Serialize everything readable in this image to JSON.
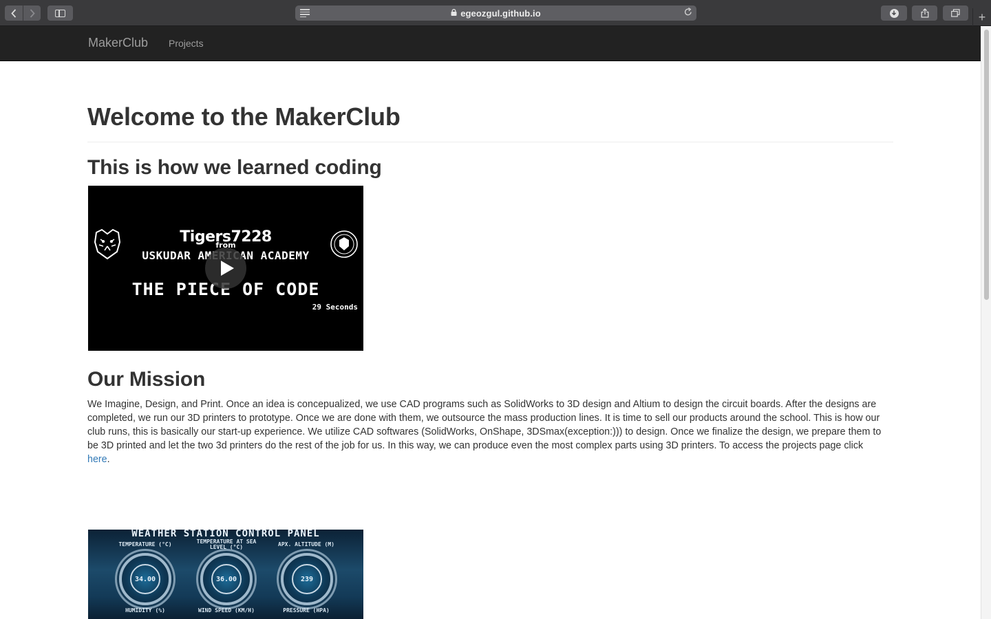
{
  "browser": {
    "url": "egeozgul.github.io",
    "back_icon": "chevron-left-icon",
    "forward_icon": "chevron-right-icon",
    "reload_icon": "reload-icon",
    "new_tab": "+"
  },
  "navbar": {
    "brand": "MakerClub",
    "links": [
      {
        "label": "Projects"
      }
    ],
    "background": "#222222",
    "link_color": "#9d9d9d"
  },
  "main": {
    "title": "Welcome to the MakerClub",
    "coding_heading": "This is how we learned coding",
    "video": {
      "title_line1": "Tigers7228",
      "from": "from",
      "school": "USKUDAR AMERICAN ACADEMY",
      "headline": "THE PIECE OF CODE",
      "duration": "29 Seconds"
    },
    "mission_heading": "Our Mission",
    "mission_text": "We Imagine, Design, and Print. Once an idea is concepualized, we use CAD programs such as SolidWorks to 3D design and Altium to design the circuit boards. After the designs are completed, we run our 3D printers to prototype. Once we are done with them, we outsource the mass production lines. It is time to sell our products around the school. This is how our club runs, this is basically our start-up experience. We utilize CAD softwares (SolidWorks, OnShape, 3DSmax(exception:))) to design. Once we finalize the design, we prepare them to be 3D printed and let the two 3d printers do the rest of the job for us. In this way, we can produce even the most complex parts using 3D printers. To access the projects page click ",
    "mission_link": "here",
    "mission_end": ".",
    "link_color": "#337ab7",
    "panel": {
      "title": "WEATHER STATION CONTROL PANEL",
      "gauges": [
        {
          "label": "TEMPERATURE (°C)",
          "value": "34.00"
        },
        {
          "label": "TEMPERATURE AT SEA LEVEL (°C)",
          "value": "36.00"
        },
        {
          "label": "APX. ALTITUDE (M)",
          "value": "239"
        }
      ],
      "bottom_labels": [
        "HUMIDITY (%)",
        "WIND SPEED (KM/H)",
        "PRESSURE (HPA)"
      ]
    }
  }
}
